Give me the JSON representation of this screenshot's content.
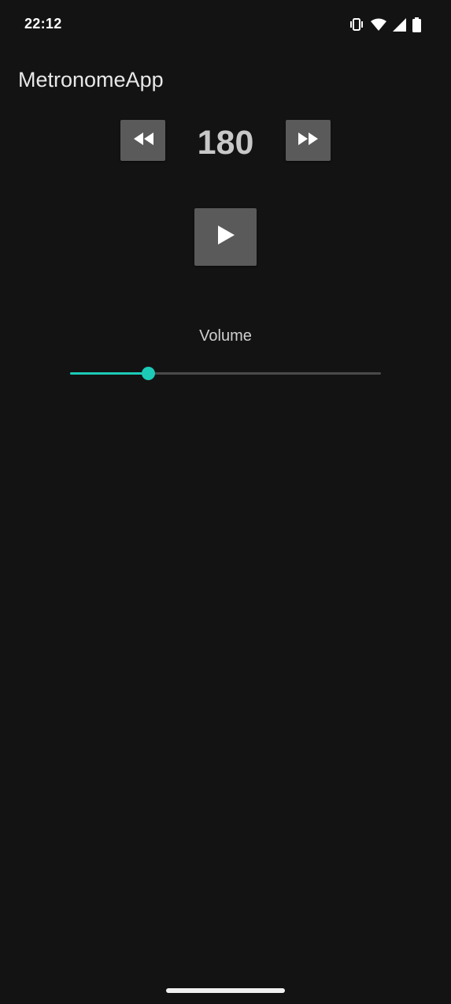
{
  "status_bar": {
    "time": "22:12",
    "icons": [
      "vibrate-icon",
      "wifi-icon",
      "cellular-signal-icon",
      "battery-icon"
    ]
  },
  "app": {
    "title": "MetronomeApp"
  },
  "tempo": {
    "bpm": "180",
    "decrease_icon": "rewind-icon",
    "increase_icon": "fast-forward-icon"
  },
  "playback": {
    "play_icon": "play-icon"
  },
  "volume": {
    "label": "Volume",
    "level": 0.25,
    "accent_color": "#1ccbb7"
  },
  "colors": {
    "background": "#131313",
    "button": "#5a5a5a",
    "accent": "#1ccbb7"
  }
}
